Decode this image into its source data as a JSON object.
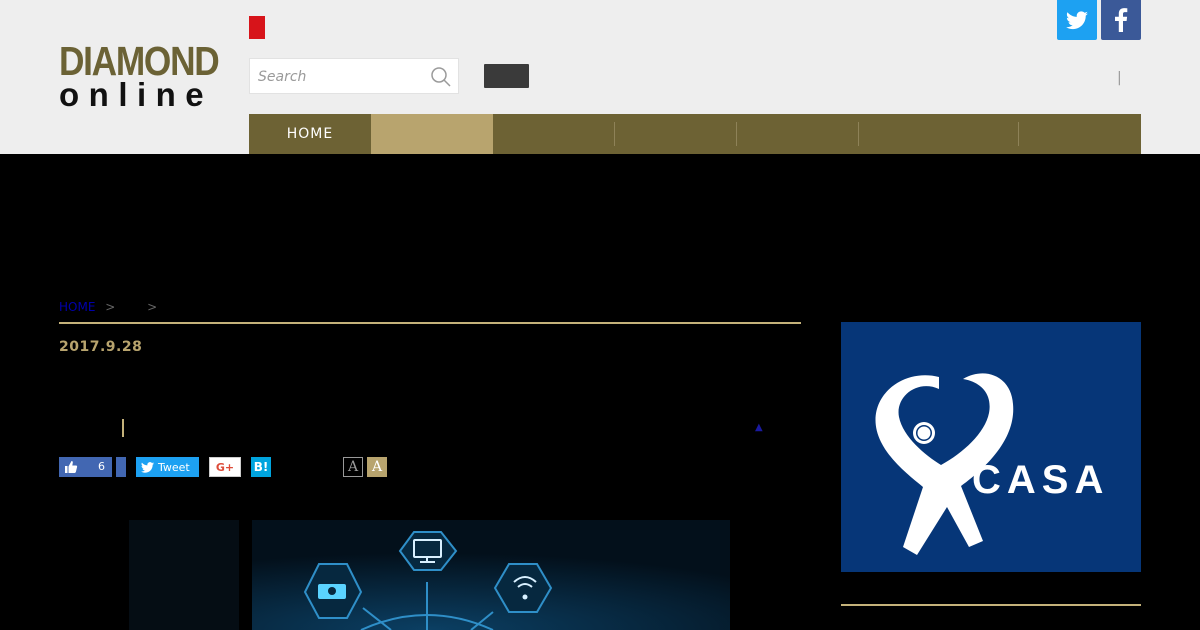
{
  "logo": {
    "line1": "DIAMOND",
    "line2": "online"
  },
  "search": {
    "placeholder": "Search"
  },
  "nav": {
    "items": [
      {
        "label": "HOME"
      },
      {
        "label": ""
      },
      {
        "label": ""
      },
      {
        "label": ""
      },
      {
        "label": ""
      },
      {
        "label": ""
      },
      {
        "label": ""
      }
    ],
    "active_index": 1
  },
  "breadcrumb": {
    "home": "HOME",
    "sep": ">"
  },
  "article": {
    "date": "2017.9.28"
  },
  "share": {
    "like_count": "6",
    "tweet_label": "Tweet",
    "gplus_label": "G+",
    "hatena_label": "B!"
  },
  "font_size": {
    "small": "A",
    "large": "A"
  },
  "ad": {
    "brand": "CASA",
    "reg": "®"
  },
  "colors": {
    "nav_bg": "#6d6234",
    "nav_active": "#b8a46e",
    "gold": "#c4b27a",
    "twitter": "#1da1f2",
    "facebook": "#3b5998",
    "ad_bg": "#063678"
  }
}
